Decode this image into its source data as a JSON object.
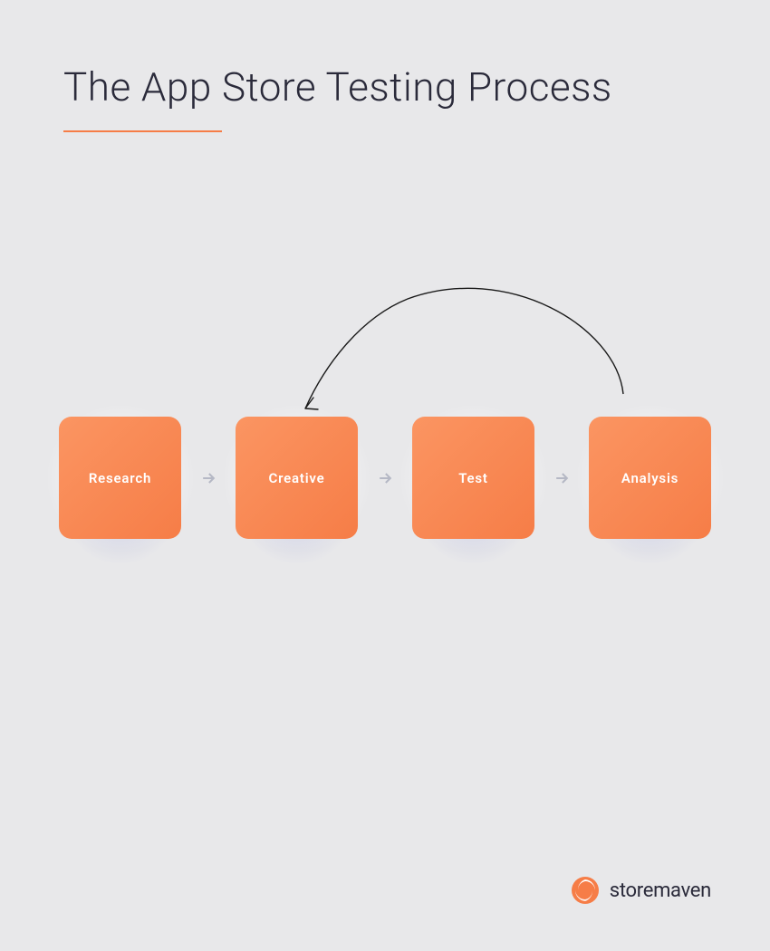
{
  "title": "The App Store Testing Process",
  "steps": [
    {
      "label": "Research"
    },
    {
      "label": "Creative"
    },
    {
      "label": "Test"
    },
    {
      "label": "Analysis"
    }
  ],
  "brand": {
    "name": "storemaven"
  },
  "colors": {
    "accent": "#f67d47",
    "background": "#E8E8EA",
    "text_dark": "#2a2a3a"
  },
  "chart_data": {
    "type": "flow-diagram",
    "nodes": [
      "Research",
      "Creative",
      "Test",
      "Analysis"
    ],
    "edges": [
      {
        "from": "Research",
        "to": "Creative"
      },
      {
        "from": "Creative",
        "to": "Test"
      },
      {
        "from": "Test",
        "to": "Analysis"
      },
      {
        "from": "Analysis",
        "to": "Creative",
        "type": "feedback-loop"
      }
    ]
  }
}
